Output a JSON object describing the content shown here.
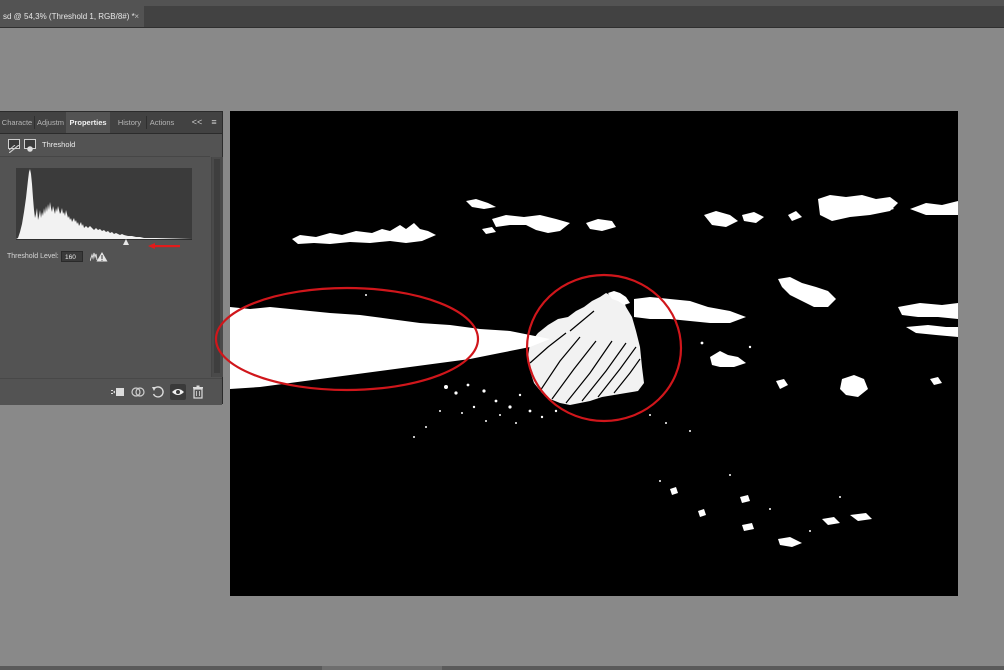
{
  "document": {
    "tab_title": "sd @ 54,3% (Threshold 1, RGB/8#) *",
    "close_symbol": "×"
  },
  "panel": {
    "tabs": [
      {
        "label": "Characte",
        "active": false
      },
      {
        "label": "Adjustm",
        "active": false
      },
      {
        "label": "Properties",
        "active": true
      },
      {
        "label": "History",
        "active": false
      },
      {
        "label": "Actions",
        "active": false
      }
    ],
    "collapse_symbol": "<<",
    "menu_symbol": "≡",
    "header": {
      "adjustment_icon": "threshold-adjustment-icon",
      "mask_icon": "layer-mask-icon",
      "title": "Threshold"
    },
    "threshold": {
      "label": "Threshold Level:",
      "value": "160",
      "level_fraction": 0.627,
      "warning_icon": "histogram-warning-icon"
    },
    "annotation_color": "#e11b1b",
    "footer_icons": [
      "clip-to-layer-icon",
      "view-previous-state-icon",
      "reset-icon",
      "visibility-eye-icon",
      "delete-trash-icon"
    ]
  },
  "canvas": {
    "content": "threshold-black-white-image",
    "annotation_color": "#d0161b"
  }
}
